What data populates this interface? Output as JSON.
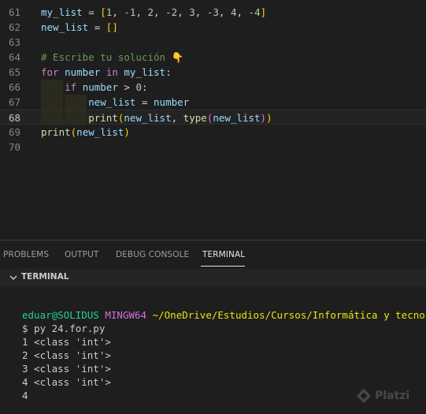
{
  "editor": {
    "lines": [
      {
        "num": "61",
        "tokens": [
          [
            "my_list",
            "var"
          ],
          [
            " = ",
            "op"
          ],
          [
            "[",
            "br1"
          ],
          [
            "1",
            "num"
          ],
          [
            ", ",
            "op"
          ],
          [
            "-1",
            "num"
          ],
          [
            ", ",
            "op"
          ],
          [
            "2",
            "num"
          ],
          [
            ", ",
            "op"
          ],
          [
            "-2",
            "num"
          ],
          [
            ", ",
            "op"
          ],
          [
            "3",
            "num"
          ],
          [
            ", ",
            "op"
          ],
          [
            "-3",
            "num"
          ],
          [
            ", ",
            "op"
          ],
          [
            "4",
            "num"
          ],
          [
            ", ",
            "op"
          ],
          [
            "-4",
            "num"
          ],
          [
            "]",
            "br1"
          ]
        ]
      },
      {
        "num": "62",
        "tokens": [
          [
            "new_list",
            "var"
          ],
          [
            " = ",
            "op"
          ],
          [
            "[]",
            "br1"
          ]
        ]
      },
      {
        "num": "63",
        "tokens": []
      },
      {
        "num": "64",
        "tokens": [
          [
            "# Escribe tu solución 👇",
            "cm"
          ]
        ]
      },
      {
        "num": "65",
        "tokens": [
          [
            "for",
            "kw"
          ],
          [
            " ",
            "op"
          ],
          [
            "number",
            "var"
          ],
          [
            " ",
            "op"
          ],
          [
            "in",
            "kw"
          ],
          [
            " ",
            "op"
          ],
          [
            "my_list",
            "var"
          ],
          [
            ":",
            "op"
          ]
        ]
      },
      {
        "num": "66",
        "tokens": [
          [
            "    ",
            "op"
          ],
          [
            "if",
            "kw"
          ],
          [
            " ",
            "op"
          ],
          [
            "number",
            "var"
          ],
          [
            " > ",
            "op"
          ],
          [
            "0",
            "num"
          ],
          [
            ":",
            "op"
          ]
        ]
      },
      {
        "num": "67",
        "tokens": [
          [
            "        ",
            "op"
          ],
          [
            "new_list",
            "var"
          ],
          [
            " = ",
            "op"
          ],
          [
            "number",
            "var"
          ]
        ]
      },
      {
        "num": "68",
        "tokens": [
          [
            "        ",
            "op"
          ],
          [
            "print",
            "fn"
          ],
          [
            "(",
            "br1"
          ],
          [
            "new_list",
            "var"
          ],
          [
            ", ",
            "op"
          ],
          [
            "type",
            "fn"
          ],
          [
            "(",
            "br2"
          ],
          [
            "new_list",
            "var"
          ],
          [
            ")",
            "br2"
          ],
          [
            ")",
            "br1"
          ]
        ]
      },
      {
        "num": "69",
        "tokens": [
          [
            "print",
            "fn"
          ],
          [
            "(",
            "br1"
          ],
          [
            "new_list",
            "var"
          ],
          [
            ")",
            "br1"
          ]
        ]
      },
      {
        "num": "70",
        "tokens": []
      }
    ],
    "active_line": "68"
  },
  "panel": {
    "tabs": [
      "PROBLEMS",
      "OUTPUT",
      "DEBUG CONSOLE",
      "TERMINAL"
    ],
    "active_tab": "TERMINAL",
    "section_title": "TERMINAL"
  },
  "terminal": {
    "prompt_user": "eduar@SOLIDUS",
    "prompt_env": "MINGW64",
    "prompt_path": "~/OneDrive/Estudios/Cursos/Informática y tecnología/",
    "command": "$ py 24.for.py",
    "output": [
      "1 <class 'int'>",
      "2 <class 'int'>",
      "3 <class 'int'>",
      "4 <class 'int'>",
      "4"
    ]
  },
  "colors": {
    "background": "#1e1e1e",
    "keyword": "#c586c0",
    "variable": "#9cdcfe",
    "number": "#b5cea8",
    "function": "#dcdcaa",
    "comment": "#6a9955",
    "bracket": "#ffd700",
    "terminal_user": "#23d18b",
    "terminal_env": "#d670d6",
    "terminal_path": "#e5e510"
  },
  "watermark": {
    "text": "Platzi",
    "icon": "platzi-logo-icon"
  }
}
